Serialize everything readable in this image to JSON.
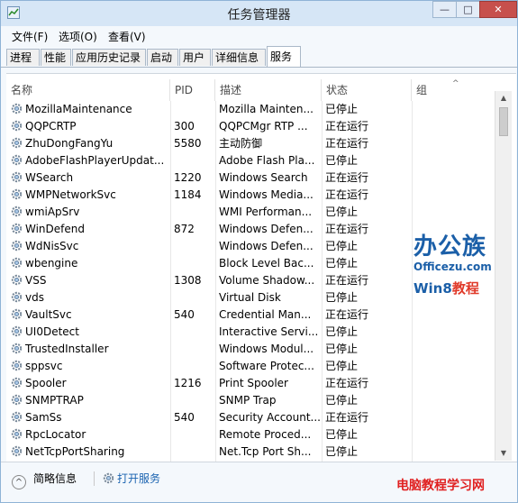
{
  "window": {
    "title": "任务管理器"
  },
  "menu": [
    "文件(F)",
    "选项(O)",
    "查看(V)"
  ],
  "tabs": [
    "进程",
    "性能",
    "应用历史记录",
    "启动",
    "用户",
    "详细信息",
    "服务"
  ],
  "active_tab": "服务",
  "columns": {
    "name": "名称",
    "pid": "PID",
    "desc": "描述",
    "status": "状态",
    "group": "组"
  },
  "services": [
    {
      "name": "MozillaMaintenance",
      "pid": "",
      "desc": "Mozilla Mainten...",
      "status": "已停止"
    },
    {
      "name": "QQPCRTP",
      "pid": "300",
      "desc": "QQPCMgr RTP ...",
      "status": "正在运行"
    },
    {
      "name": "ZhuDongFangYu",
      "pid": "5580",
      "desc": "主动防御",
      "status": "正在运行"
    },
    {
      "name": "AdobeFlashPlayerUpdat...",
      "pid": "",
      "desc": "Adobe Flash Pla...",
      "status": "已停止"
    },
    {
      "name": "WSearch",
      "pid": "1220",
      "desc": "Windows Search",
      "status": "正在运行"
    },
    {
      "name": "WMPNetworkSvc",
      "pid": "1184",
      "desc": "Windows Media...",
      "status": "正在运行"
    },
    {
      "name": "wmiApSrv",
      "pid": "",
      "desc": "WMI Performan...",
      "status": "已停止"
    },
    {
      "name": "WinDefend",
      "pid": "872",
      "desc": "Windows Defen...",
      "status": "正在运行"
    },
    {
      "name": "WdNisSvc",
      "pid": "",
      "desc": "Windows Defen...",
      "status": "已停止"
    },
    {
      "name": "wbengine",
      "pid": "",
      "desc": "Block Level Bac...",
      "status": "已停止"
    },
    {
      "name": "VSS",
      "pid": "1308",
      "desc": "Volume Shadow...",
      "status": "正在运行"
    },
    {
      "name": "vds",
      "pid": "",
      "desc": "Virtual Disk",
      "status": "已停止"
    },
    {
      "name": "VaultSvc",
      "pid": "540",
      "desc": "Credential Man...",
      "status": "正在运行"
    },
    {
      "name": "UI0Detect",
      "pid": "",
      "desc": "Interactive Servi...",
      "status": "已停止"
    },
    {
      "name": "TrustedInstaller",
      "pid": "",
      "desc": "Windows Modul...",
      "status": "已停止"
    },
    {
      "name": "sppsvc",
      "pid": "",
      "desc": "Software Protec...",
      "status": "已停止"
    },
    {
      "name": "Spooler",
      "pid": "1216",
      "desc": "Print Spooler",
      "status": "正在运行"
    },
    {
      "name": "SNMPTRAP",
      "pid": "",
      "desc": "SNMP Trap",
      "status": "已停止"
    },
    {
      "name": "SamSs",
      "pid": "540",
      "desc": "Security Account...",
      "status": "正在运行"
    },
    {
      "name": "RpcLocator",
      "pid": "",
      "desc": "Remote Proced...",
      "status": "已停止"
    },
    {
      "name": "NetTcpPortSharing",
      "pid": "",
      "desc": "Net.Tcp Port Sh...",
      "status": "已停止"
    }
  ],
  "bottom": {
    "fewer_details": "简略信息",
    "open_services": "打开服务"
  },
  "watermark": {
    "brand": "办公族",
    "url": "Officezu.com",
    "win8": "Win8",
    "tutorial": "教程"
  },
  "footer_brand": "电脑教程学习网",
  "icons": {
    "app": "task-manager-icon",
    "service": "gear-icon",
    "collapse": "chevron-up-icon"
  },
  "colors": {
    "titlebar": "#d6e6f6",
    "close_button": "#c7504c",
    "brand_blue": "#1b5fa8",
    "brand_red": "#e02020"
  }
}
